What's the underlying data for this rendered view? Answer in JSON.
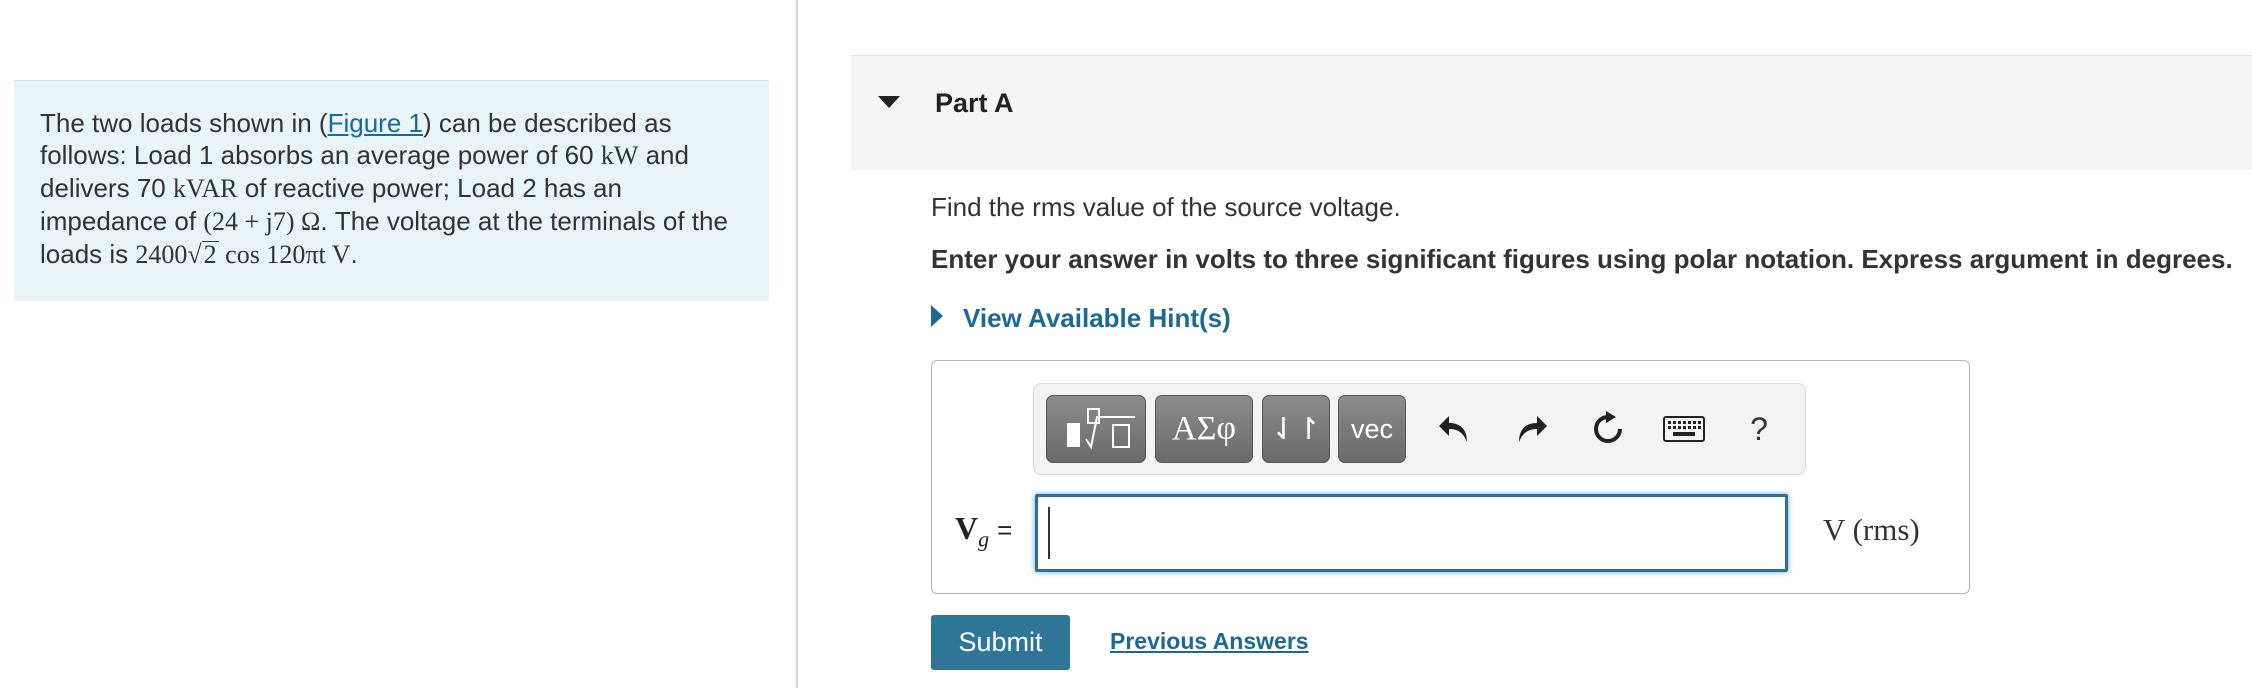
{
  "problem": {
    "text_1": "The two loads shown in (",
    "figure_link": "Figure 1",
    "text_2": ") can be described as follows: Load 1 absorbs an average power of 60 ",
    "kw": "kW",
    "text_3": " and delivers 70 ",
    "kvar": "kVAR",
    "text_4": " of reactive power; Load 2 has an impedance of ",
    "impedance": "(24 + j7)  Ω",
    "text_5": ". The voltage at the terminals of the loads is ",
    "voltage_prefix": "2400",
    "voltage_radicand": "2",
    "voltage_suffix": " cos 120πt V",
    "text_6": "."
  },
  "part": {
    "title": "Part A",
    "question": "Find the rms value of the source voltage.",
    "instruction": "Enter your answer in volts to three significant figures using polar notation. Express argument in degrees.",
    "hint_link": "View Available Hint(s)"
  },
  "toolbar": {
    "templates_icon": "fraction-sqrt-templates-icon",
    "greek_label": "ΑΣφ",
    "arrows_label": "⇃↾",
    "vec_label": "vec",
    "undo_icon": "undo-icon",
    "redo_icon": "redo-icon",
    "reset_icon": "reset-icon",
    "keyboard_icon": "keyboard-icon",
    "help_label": "?"
  },
  "answer": {
    "var_main": "V",
    "var_sub": "g",
    "equals": "=",
    "value": "",
    "unit": "V  (rms)"
  },
  "actions": {
    "submit": "Submit",
    "previous": "Previous Answers"
  },
  "colors": {
    "link": "#1a6a95",
    "submit_bg": "#2d7697",
    "panel_bg": "#e9f4f6"
  }
}
